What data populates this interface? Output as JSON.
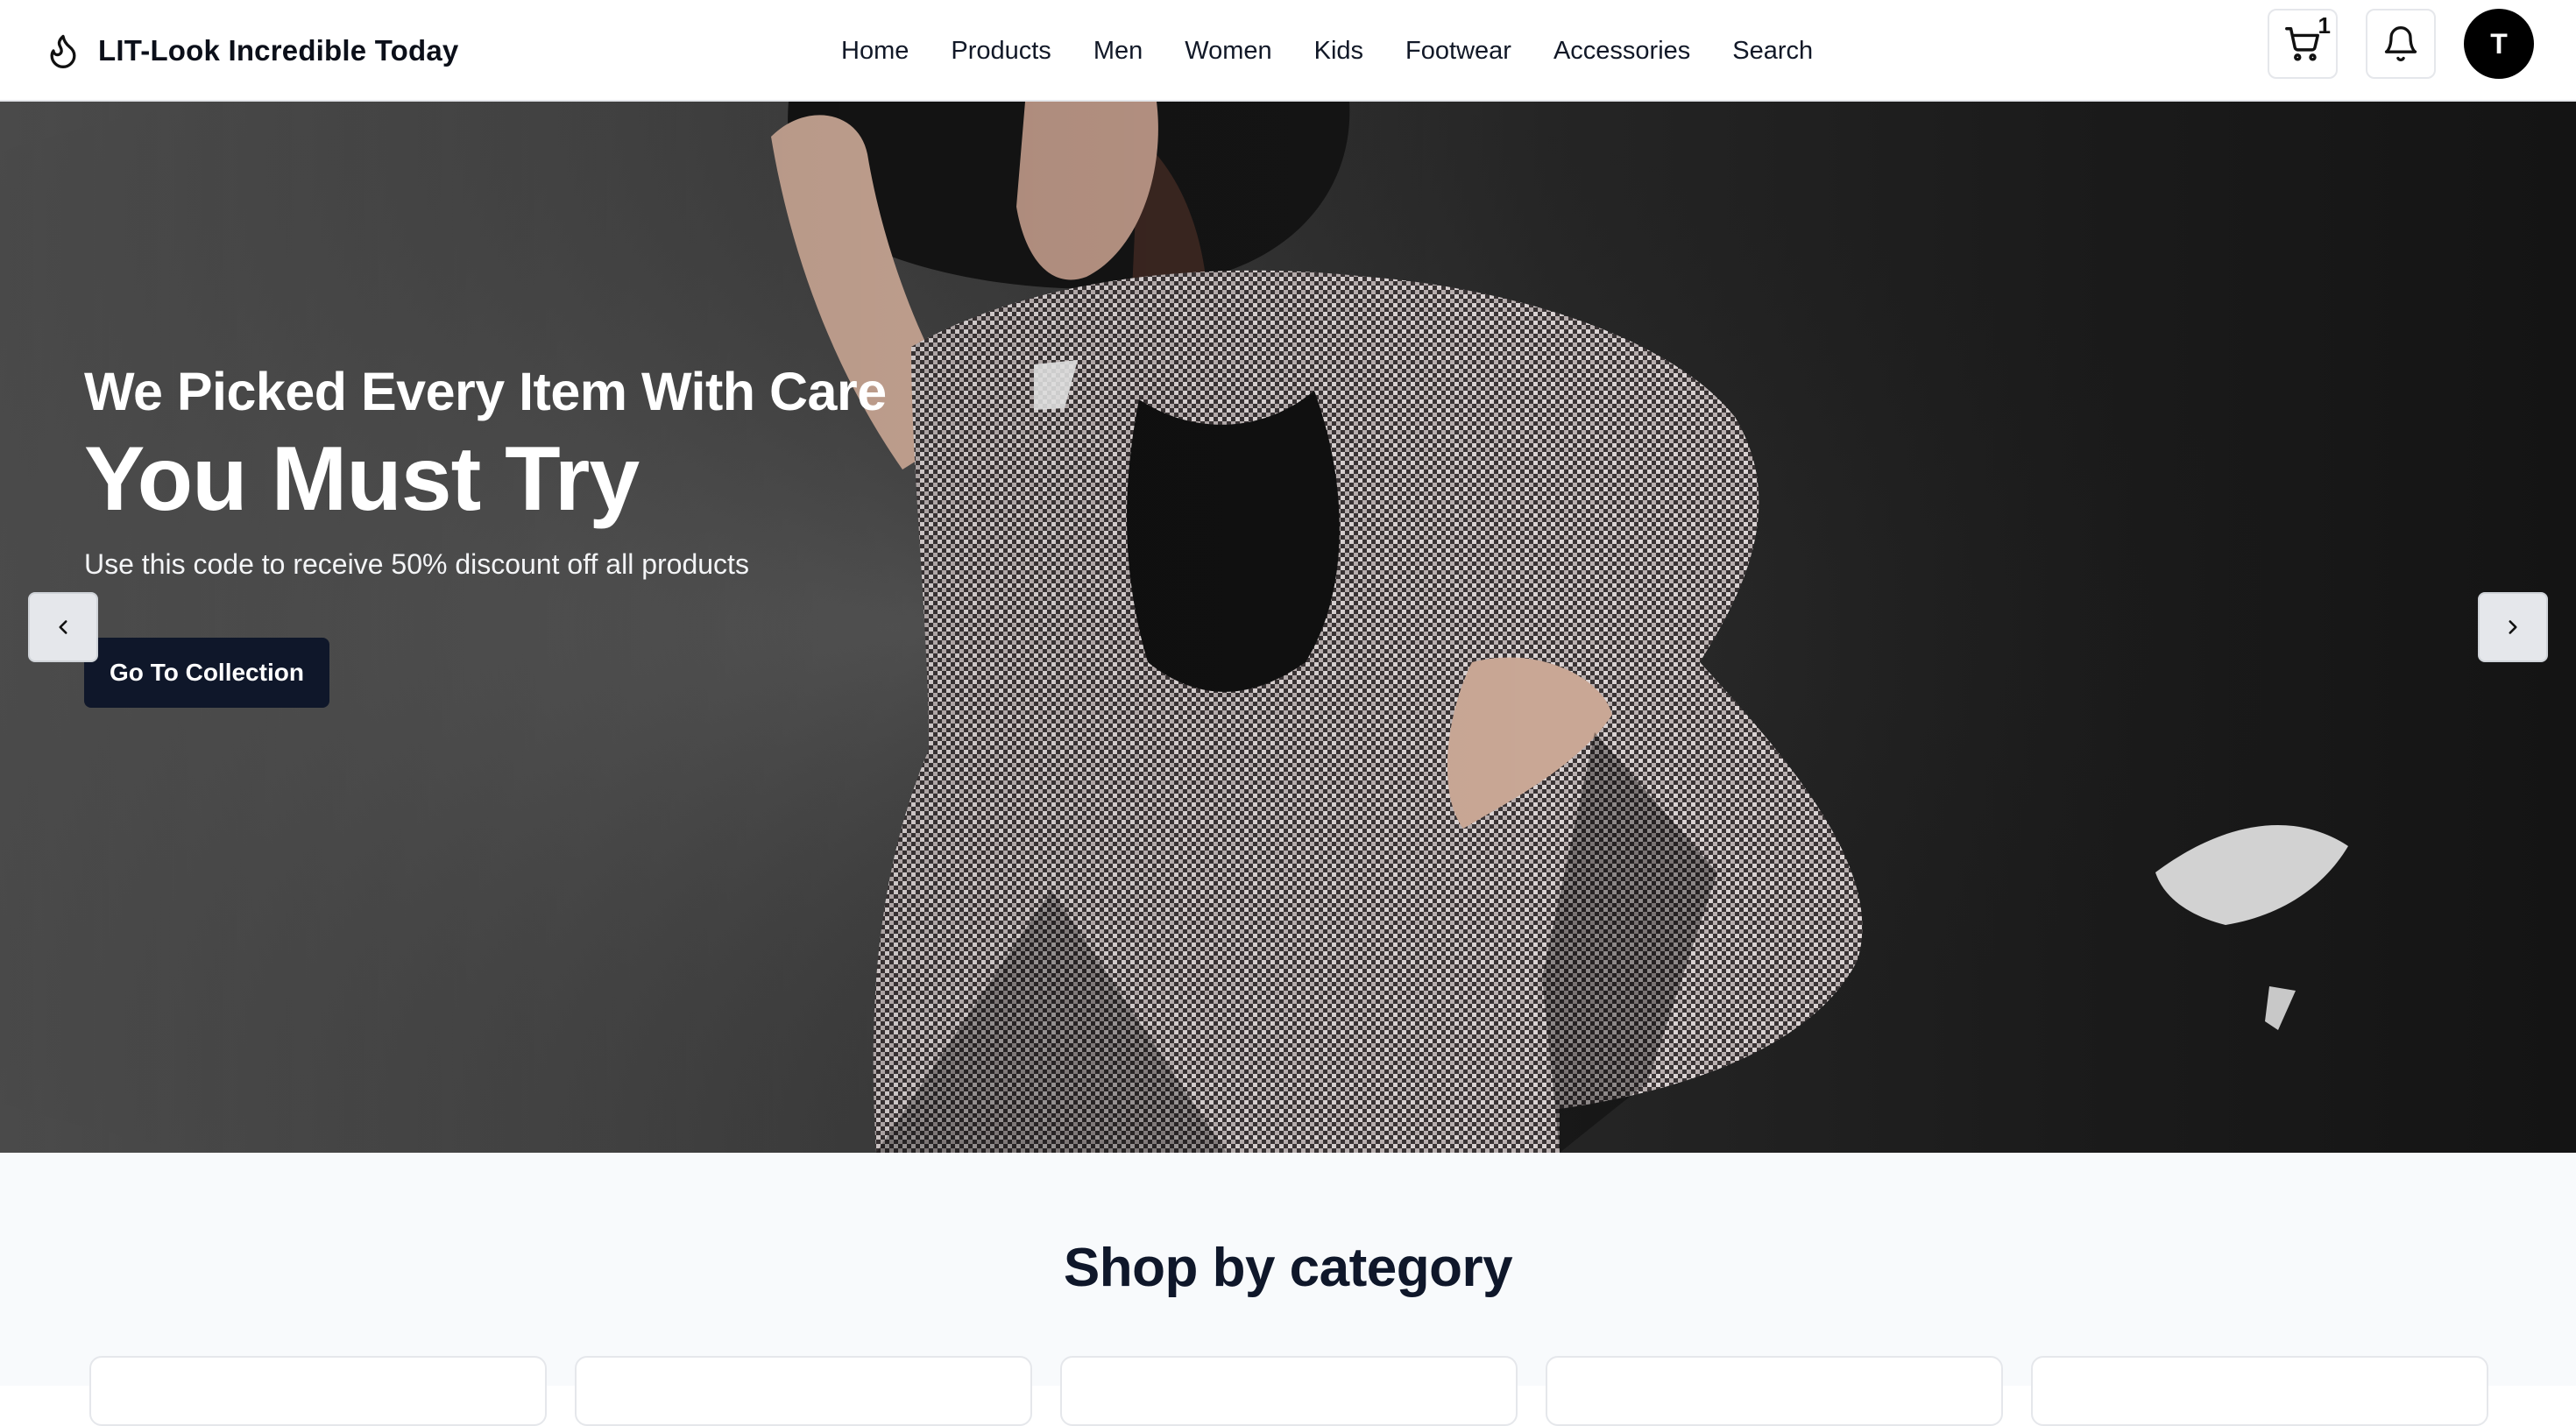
{
  "navbar": {
    "brand_name": "LIT-Look Incredible Today",
    "brand_icon": "flame-icon",
    "links": [
      "Home",
      "Products",
      "Men",
      "Women",
      "Kids",
      "Footwear",
      "Accessories",
      "Search"
    ],
    "cart_icon": "cart-icon",
    "cart_count": "1",
    "notification_icon": "bell-icon",
    "avatar_initial": "T"
  },
  "hero": {
    "eyebrow": "We Picked Every Item With Care",
    "title": "You Must Try",
    "subtitle": "Use this code to receive 50% discount off all products",
    "cta_label": "Go To Collection",
    "prev_icon": "chevron-left-icon",
    "next_icon": "chevron-right-icon"
  },
  "categories": {
    "title": "Shop by category",
    "cards": [
      {},
      {},
      {},
      {},
      {}
    ]
  },
  "colors": {
    "primary_dark": "#0f172a",
    "avatar_bg": "#000000",
    "section_bg": "#f8fafc",
    "border": "#e5e7eb"
  }
}
